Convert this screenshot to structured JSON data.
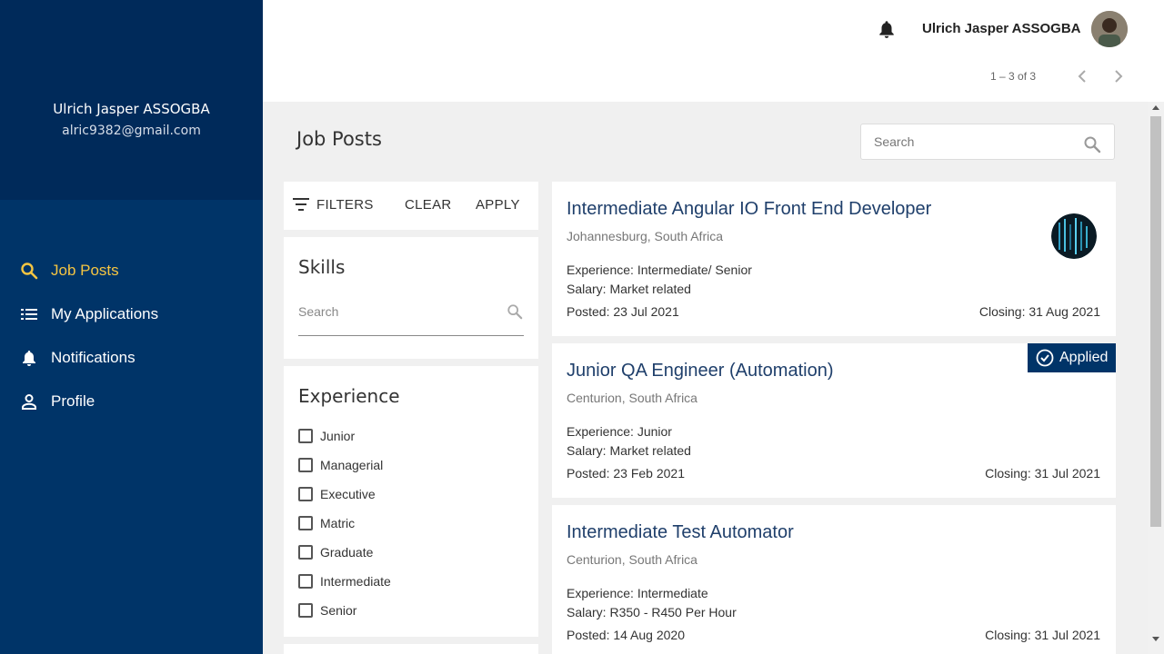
{
  "sidebar": {
    "user_name": "Ulrich Jasper ASSOGBA",
    "user_email": "alric9382@gmail.com",
    "items": [
      {
        "label": "Job Posts",
        "icon": "search-icon",
        "active": true
      },
      {
        "label": "My Applications",
        "icon": "list-icon",
        "active": false
      },
      {
        "label": "Notifications",
        "icon": "bell-icon",
        "active": false
      },
      {
        "label": "Profile",
        "icon": "person-icon",
        "active": false
      }
    ]
  },
  "topbar": {
    "user_name": "Ulrich Jasper ASSOGBA",
    "paginator": "1 – 3 of 3"
  },
  "main": {
    "title": "Job Posts",
    "search_placeholder": "Search"
  },
  "filters": {
    "label": "FILTERS",
    "clear": "CLEAR",
    "apply": "APPLY",
    "skills_title": "Skills",
    "skills_placeholder": "Search",
    "experience_title": "Experience",
    "experience_options": [
      "Junior",
      "Managerial",
      "Executive",
      "Matric",
      "Graduate",
      "Intermediate",
      "Senior"
    ]
  },
  "jobs": [
    {
      "title": "Intermediate Angular IO Front End Developer",
      "location": "Johannesburg, South Africa",
      "experience": "Experience: Intermediate/ Senior",
      "salary": "Salary: Market related",
      "posted": "Posted: 23 Jul 2021",
      "closing": "Closing: 31 Aug 2021",
      "has_logo": true
    },
    {
      "title": "Junior QA Engineer (Automation)",
      "location": "Centurion, South Africa",
      "experience": "Experience: Junior",
      "salary": "Salary: Market related",
      "posted": "Posted: 23 Feb 2021",
      "closing": "Closing: 31 Jul 2021",
      "badge": "Applied"
    },
    {
      "title": "Intermediate Test Automator",
      "location": "Centurion, South Africa",
      "experience": "Experience: Intermediate",
      "salary": "Salary: R350 - R450 Per Hour",
      "posted": "Posted: 14 Aug 2020",
      "closing": "Closing: 31 Jul 2021"
    }
  ],
  "colors": {
    "sidebar_bg": "#003468",
    "sidebar_header_bg": "#002a5a",
    "active_nav": "#f5c542",
    "job_title": "#1f3f6b"
  }
}
